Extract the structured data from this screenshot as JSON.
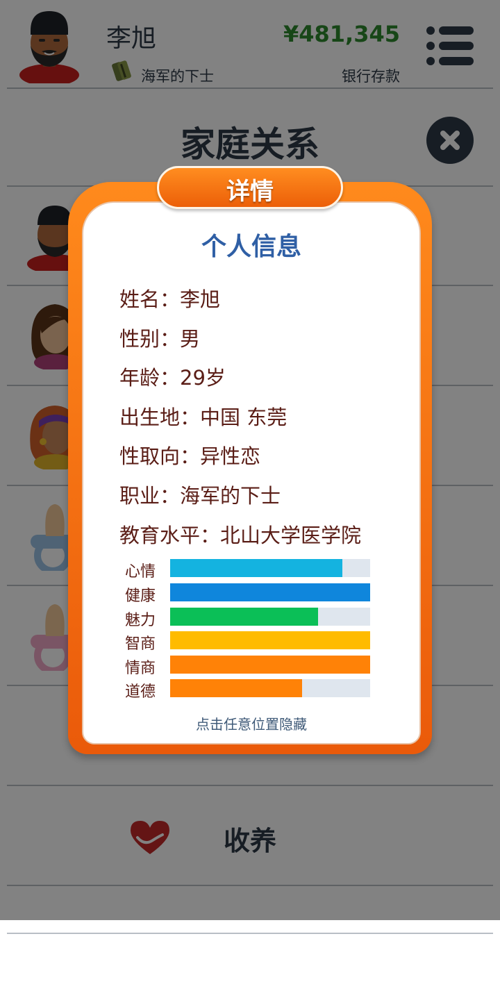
{
  "header": {
    "player_name": "李旭",
    "job": "海军的下士",
    "money": "¥481,345",
    "money_label": "银行存款"
  },
  "section": {
    "title": "家庭关系",
    "adopt_label": "收养"
  },
  "modal": {
    "tab_label": "详情",
    "title": "个人信息",
    "rows": [
      "姓名：李旭",
      "性别：男",
      "年龄：29岁",
      "出生地：中国 东莞",
      "性取向：异性恋",
      "职业：海军的下士",
      "教育水平：北山大学医学院"
    ],
    "stats": [
      {
        "label": "心情",
        "value": 0.86,
        "color": "#14b3e0"
      },
      {
        "label": "健康",
        "value": 1.0,
        "color": "#0f86dc"
      },
      {
        "label": "魅力",
        "value": 0.74,
        "color": "#0bbf57"
      },
      {
        "label": "智商",
        "value": 1.0,
        "color": "#ffbb00"
      },
      {
        "label": "情商",
        "value": 1.0,
        "color": "#ff8207"
      },
      {
        "label": "道德",
        "value": 0.66,
        "color": "#ff8207"
      }
    ],
    "hint": "点击任意位置隐藏"
  },
  "colors": {
    "accent_orange": "#f26a0d",
    "money_green": "#2d8a2d",
    "title_blue": "#2f5fa5",
    "text_dark": "#2e3a48"
  }
}
